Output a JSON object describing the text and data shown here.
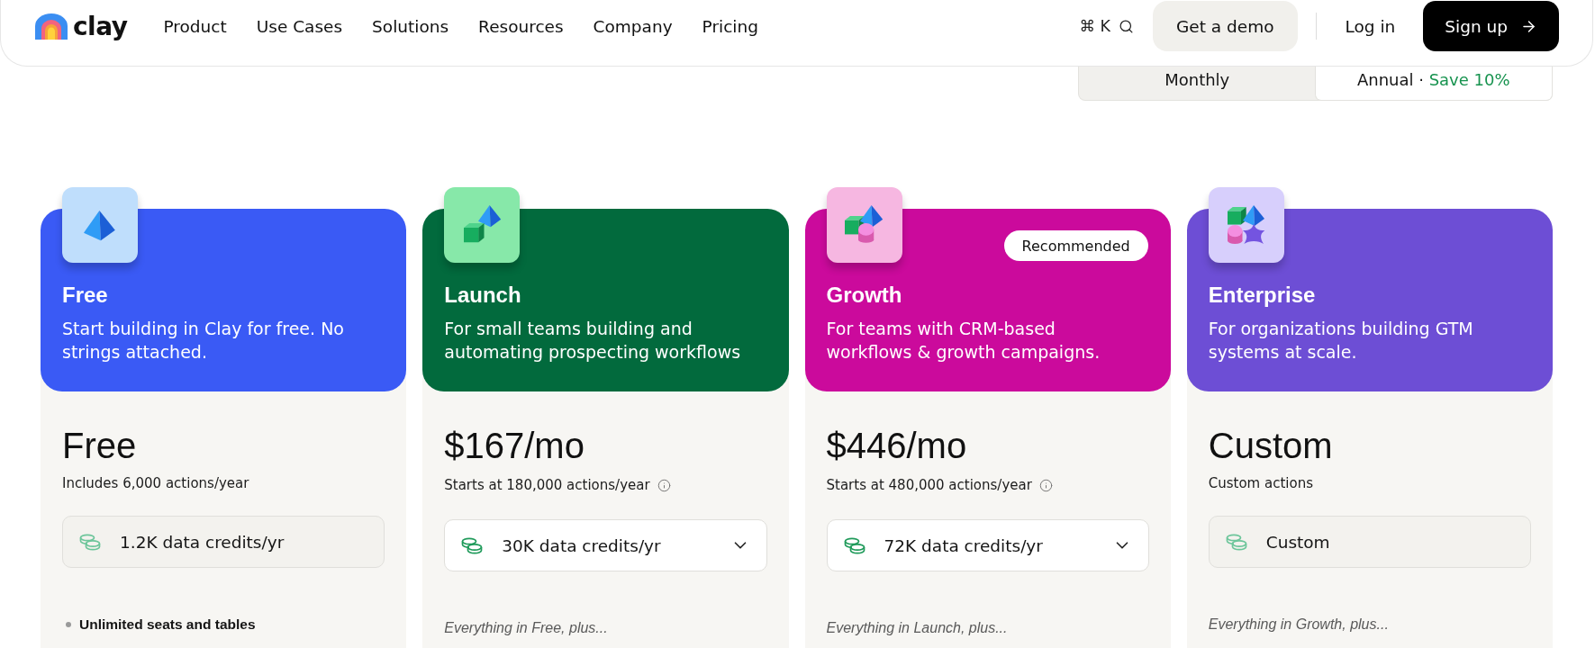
{
  "header": {
    "logo": "clay",
    "nav": [
      "Product",
      "Use Cases",
      "Solutions",
      "Resources",
      "Company",
      "Pricing"
    ],
    "shortcut": "⌘ K",
    "demo_button": "Get a demo",
    "login": "Log in",
    "signup": "Sign up"
  },
  "billing_toggle": [
    {
      "label": "Monthly",
      "selected": false
    },
    {
      "label": "Annual ·",
      "note": "Save 10%",
      "selected": true
    }
  ],
  "plans": [
    {
      "name": "Free",
      "description": "Start building in Clay for free. No strings attached.",
      "color": "#3a5af5",
      "price": "Free",
      "actions": "Includes 6,000 actions/year",
      "actions_info": false,
      "credits": {
        "kind": "static",
        "label": "1.2K data credits/yr"
      },
      "features": [
        "Unlimited seats and tables"
      ]
    },
    {
      "name": "Launch",
      "description": "For small teams building and automating prospecting workflows",
      "color": "#026a3d",
      "price": "$167/mo",
      "actions": "Starts at 180,000 actions/year",
      "actions_info": true,
      "credits": {
        "kind": "dropdown",
        "label": "30K data credits/yr"
      },
      "features_intro": "Everything in Free, plus..."
    },
    {
      "name": "Growth",
      "description": "For teams with CRM-based workflows & growth campaigns.",
      "color": "#cb0a9c",
      "badge": "Recommended",
      "price": "$446/mo",
      "actions": "Starts at 480,000 actions/year",
      "actions_info": true,
      "credits": {
        "kind": "dropdown",
        "label": "72K data credits/yr"
      },
      "features_intro": "Everything in Launch, plus..."
    },
    {
      "name": "Enterprise",
      "description": "For organizations building GTM systems at scale.",
      "color": "#6d4ed5",
      "price": "Custom",
      "actions": "Custom actions",
      "actions_info": false,
      "credits": {
        "kind": "static",
        "label": "Custom"
      },
      "features_intro": "Everything in Growth, plus..."
    }
  ]
}
